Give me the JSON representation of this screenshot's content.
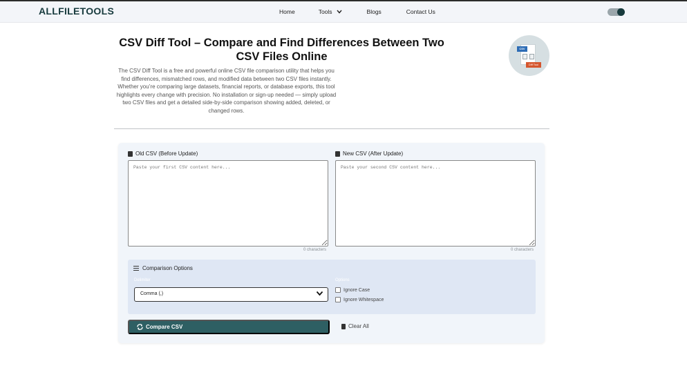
{
  "brand": {
    "logo": "ALLFILETOOLS"
  },
  "nav": {
    "items": [
      {
        "label": "Home"
      },
      {
        "label": "Tools"
      },
      {
        "label": "Blogs"
      },
      {
        "label": "Contact Us"
      }
    ],
    "theme_toggle": "dark-mode-toggle"
  },
  "hero": {
    "title": "CSV Diff Tool – Compare and Find Differences Between Two CSV Files Online",
    "description": "The CSV Diff Tool is a free and powerful online CSV file comparison utility that helps you find differences, mismatched rows, and modified data between two CSV files instantly. Whether you’re comparing large datasets, financial reports, or database exports, this tool highlights every change with precision. No installation or sign-up needed — simply upload two CSV files and get a detailed side-by-side comparison showing added, deleted, or changed rows.",
    "image_labels": {
      "csv_tag": "CSV",
      "diff_tag": "Diff Tool"
    }
  },
  "editor": {
    "old": {
      "label": "Old CSV (Before Update)",
      "placeholder": "Paste your first CSV content here...",
      "count": "0 characters"
    },
    "new": {
      "label": "New CSV (After Update)",
      "placeholder": "Paste your second CSV content here...",
      "count": "0 characters"
    }
  },
  "options": {
    "title": "Comparison Options",
    "delimiter_label": "Delimiter",
    "delimiter_value": "Comma (,)",
    "options_label": "Options",
    "ignore_case": "Ignore Case",
    "ignore_whitespace": "Ignore Whitespace"
  },
  "actions": {
    "compare": "Compare CSV",
    "clear": "Clear All"
  },
  "colors": {
    "primary": "#2e5f63",
    "logo": "#173a3d",
    "panel": "#f1f5fa",
    "options_bg": "#dfe7f4"
  }
}
